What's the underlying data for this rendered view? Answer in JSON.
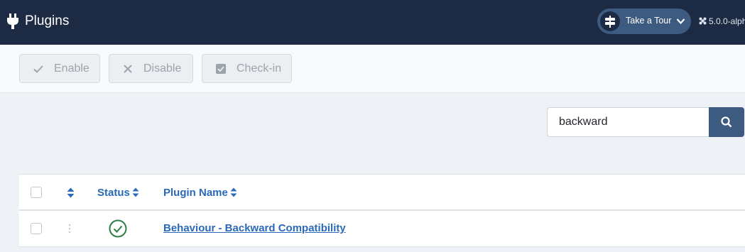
{
  "header": {
    "title": "Plugins",
    "tour_label": "Take a Tour",
    "version": "5.0.0-alph"
  },
  "toolbar": {
    "enable_label": "Enable",
    "disable_label": "Disable",
    "checkin_label": "Check-in"
  },
  "search": {
    "value": "backward"
  },
  "table": {
    "columns": {
      "status": "Status",
      "plugin_name": "Plugin Name"
    },
    "rows": [
      {
        "name": "Behaviour - Backward Compatibility",
        "status": "enabled"
      }
    ]
  },
  "colors": {
    "header_bg": "#1c2b43",
    "accent": "#3d5a80",
    "link": "#2a69b8",
    "status_enabled": "#2f7d46"
  },
  "icons": {
    "header": "plug-icon",
    "tour": "signpost-icon",
    "version": "joomla-icon",
    "search": "search-icon",
    "status": "check-circle-icon"
  }
}
